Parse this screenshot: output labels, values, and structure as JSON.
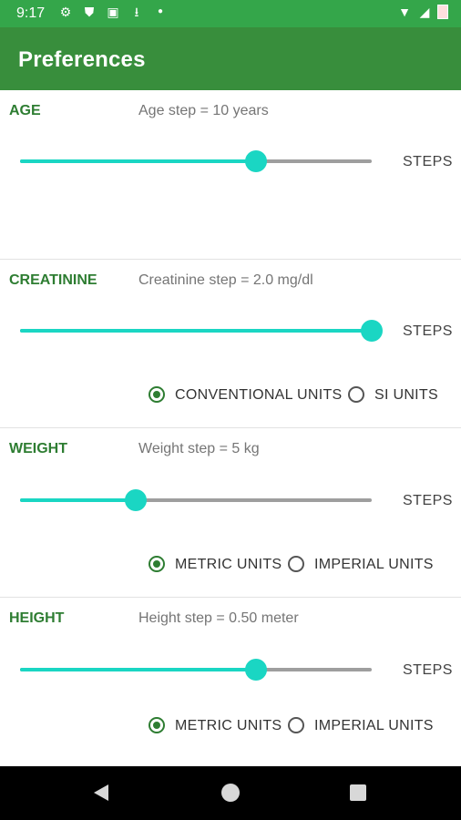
{
  "status": {
    "time": "9:17",
    "icons": [
      "settings-icon",
      "shield-icon",
      "app-icon",
      "download-icon",
      "dot-icon"
    ],
    "right_icons": [
      "wifi-icon",
      "signal-icon",
      "battery-icon"
    ]
  },
  "app_bar": {
    "title": "Preferences"
  },
  "sections": [
    {
      "title": "AGE",
      "step_text": "Age step = 10 years",
      "steps_label": "STEPS",
      "slider_level": 0.67
    },
    {
      "title": "CREATININE",
      "step_text": "Creatinine step = 2.0 mg/dl",
      "steps_label": "STEPS",
      "slider_level": 1.0,
      "radios": [
        {
          "label": "CONVENTIONAL UNITS",
          "checked": true
        },
        {
          "label": "SI UNITS",
          "checked": false
        }
      ]
    },
    {
      "title": "WEIGHT",
      "step_text": "Weight step = 5 kg",
      "steps_label": "STEPS",
      "slider_level": 0.33,
      "radios": [
        {
          "label": "METRIC UNITS",
          "checked": true
        },
        {
          "label": "IMPERIAL UNITS",
          "checked": false
        }
      ]
    },
    {
      "title": "HEIGHT",
      "step_text": "Height step = 0.50 meter",
      "steps_label": "STEPS",
      "slider_level": 0.67,
      "radios": [
        {
          "label": "METRIC UNITS",
          "checked": true
        },
        {
          "label": "IMPERIAL UNITS",
          "checked": false
        }
      ]
    }
  ],
  "nav": {
    "icons": [
      "back-icon",
      "home-icon",
      "recents-icon"
    ]
  },
  "colors": {
    "app_bar": "#388e3c",
    "status_bar": "#34a64a",
    "accent": "#1ad6c3",
    "section_title": "#2e7d32"
  }
}
